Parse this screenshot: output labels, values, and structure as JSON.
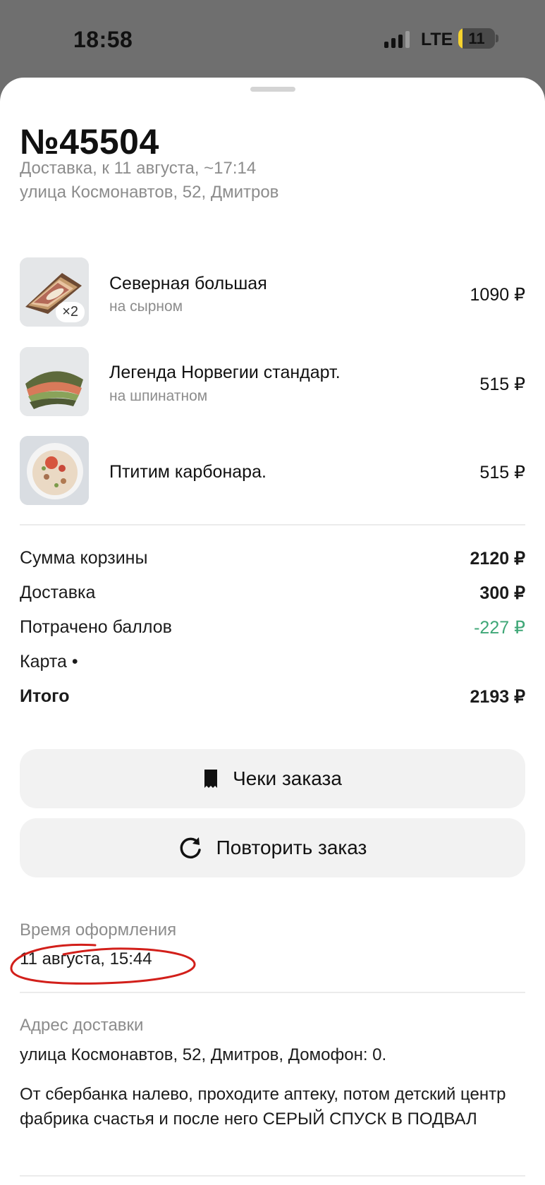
{
  "status_bar": {
    "time": "18:58",
    "network": "LTE",
    "battery": "11",
    "battery_level": 0.11
  },
  "order": {
    "number": "№45504",
    "delivery_line": "Доставка, к 11 августа, ~17:14",
    "address_line": "улица Космонавтов, 52, Дмитров"
  },
  "items": [
    {
      "name": "Северная большая",
      "modifier": "на сырном",
      "price": "1090 ₽",
      "qty": "×2",
      "image_icon": "wrap-sandwich-photo"
    },
    {
      "name": "Легенда Норвегии стандарт.",
      "modifier": "на шпинатном",
      "price": "515 ₽",
      "image_icon": "wrap-sandwich-photo"
    },
    {
      "name": "Птитим карбонара.",
      "price": "515 ₽",
      "image_icon": "salad-bowl-photo"
    }
  ],
  "summary": {
    "basket_label": "Сумма корзины",
    "basket_value": "2120 ₽",
    "delivery_label": "Доставка",
    "delivery_value": "300 ₽",
    "points_label": "Потрачено баллов",
    "points_value": "-227 ₽",
    "card_label": "Карта •",
    "total_label": "Итого",
    "total_value": "2193 ₽"
  },
  "buttons": {
    "receipts": "Чеки заказа",
    "repeat": "Повторить заказ"
  },
  "details": {
    "created_label": "Время оформления",
    "created_value": "11 августа, 15:44",
    "address_label": "Адрес доставки",
    "address_value": "улица Космонавтов, 52, Дмитров, Домофон: 0.",
    "comment": "От сбербанка налево, проходите аптеку, потом детский центр фабрика счастья и после него СЕРЫЙ СПУСК В ПОДВАЛ"
  },
  "colors": {
    "accent_green": "#3fa777",
    "annotation_red": "#d21f1a"
  }
}
